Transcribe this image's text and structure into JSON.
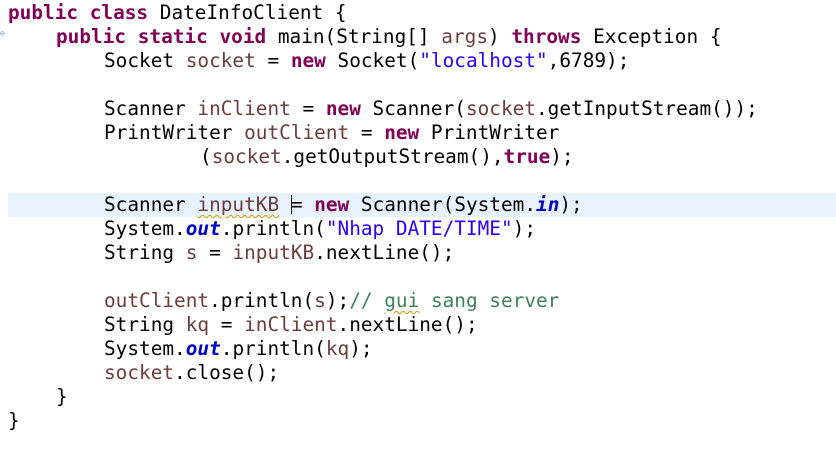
{
  "editor": {
    "language": "java",
    "colors": {
      "keyword": "#7f0055",
      "string": "#2a00ff",
      "field": "#0000c0",
      "comment": "#3f7f5f",
      "local_var": "#6a3e3e",
      "current_line": "#e8f2fe"
    },
    "lines": [
      {
        "tokens": [
          "public",
          " ",
          "class",
          " DateInfoClient {"
        ]
      },
      {
        "tokens": [
          "public",
          " ",
          "static",
          " ",
          "void",
          " main(String[] ",
          "args",
          ") ",
          "throws",
          " Exception {"
        ]
      },
      {
        "tokens": [
          "Socket ",
          "socket",
          " = ",
          "new",
          " Socket(",
          "\"localhost\"",
          ",6789);"
        ]
      },
      {
        "tokens": []
      },
      {
        "tokens": [
          "Scanner ",
          "inClient",
          " = ",
          "new",
          " Scanner(",
          "socket",
          ".getInputStream());"
        ]
      },
      {
        "tokens": [
          "PrintWriter ",
          "outClient",
          " = ",
          "new",
          " PrintWriter"
        ]
      },
      {
        "tokens": [
          "(",
          "socket",
          ".getOutputStream(),",
          "true",
          ");"
        ]
      },
      {
        "tokens": []
      },
      {
        "tokens": [
          "Scanner ",
          "inputKB",
          " ",
          "= ",
          "new",
          " Scanner(System.",
          "in",
          ");"
        ]
      },
      {
        "tokens": [
          "System.",
          "out",
          ".println(",
          "\"Nhap DATE/TIME\"",
          ");"
        ]
      },
      {
        "tokens": [
          "String ",
          "s",
          " = ",
          "inputKB",
          ".nextLine();"
        ]
      },
      {
        "tokens": []
      },
      {
        "tokens": [
          "outClient",
          ".println(",
          "s",
          ");",
          "// ",
          "gui",
          " sang server"
        ]
      },
      {
        "tokens": [
          "String ",
          "kq",
          " = ",
          "inClient",
          ".nextLine();"
        ]
      },
      {
        "tokens": [
          "System.",
          "out",
          ".println(",
          "kq",
          ");"
        ]
      },
      {
        "tokens": [
          "socket",
          ".close();"
        ]
      },
      {
        "tokens": [
          "}"
        ]
      },
      {
        "tokens": [
          "}"
        ]
      }
    ]
  }
}
